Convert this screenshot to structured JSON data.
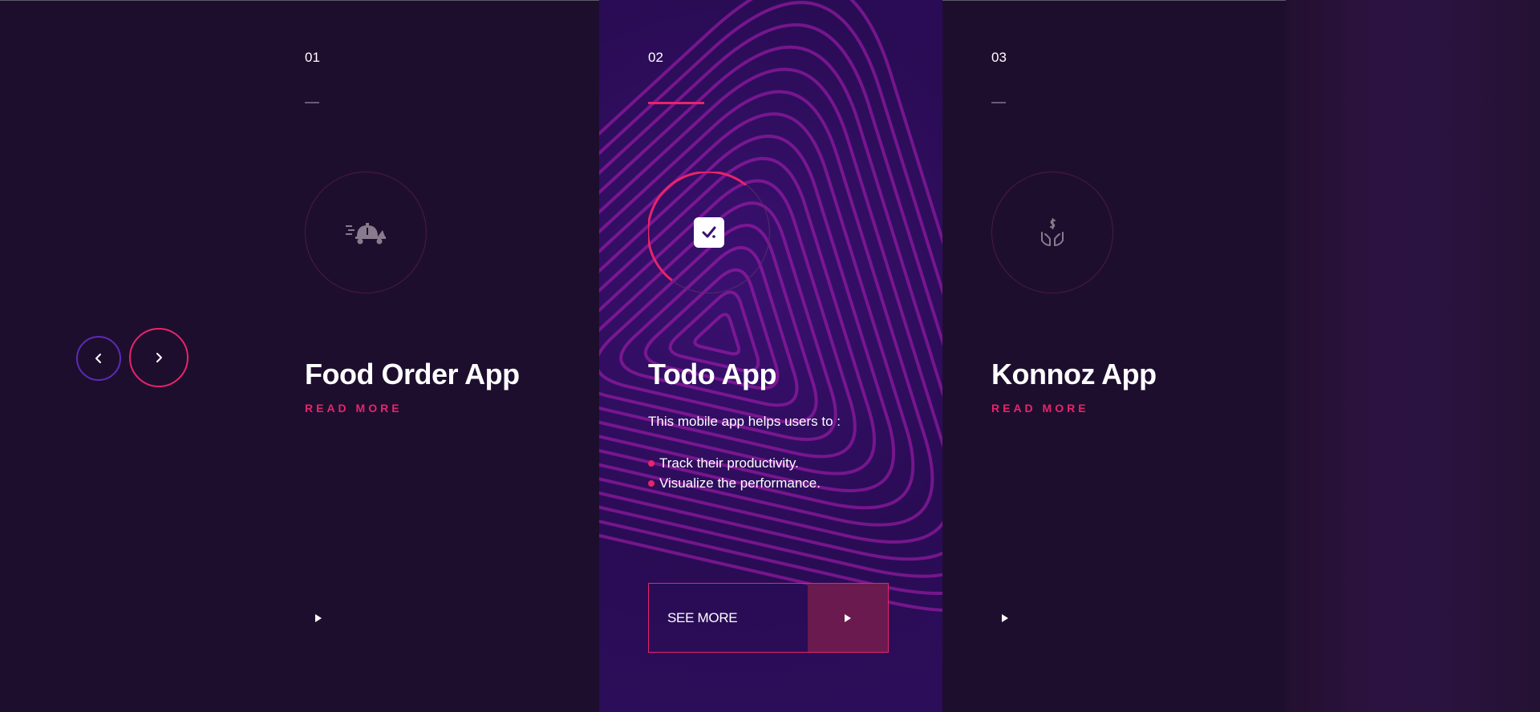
{
  "slides": [
    {
      "number": "01",
      "title": "Food Order App",
      "read_more": "READ MORE",
      "icon": "food-delivery-icon"
    },
    {
      "number": "02",
      "title": "Todo App",
      "icon": "todo-checkbox-icon",
      "description": "This mobile app helps users to :",
      "bullets": [
        "Track their productivity.",
        "Visualize the performance."
      ],
      "see_more": "SEE MORE"
    },
    {
      "number": "03",
      "title": "Konnoz App",
      "read_more": "READ MORE",
      "icon": "money-hands-icon"
    }
  ],
  "nav": {
    "prev_icon": "chevron-left-icon",
    "next_icon": "chevron-right-icon"
  },
  "colors": {
    "accent": "#e8246a",
    "background": "#1e0e2e",
    "nav_prev_border": "#5b2bb5"
  }
}
